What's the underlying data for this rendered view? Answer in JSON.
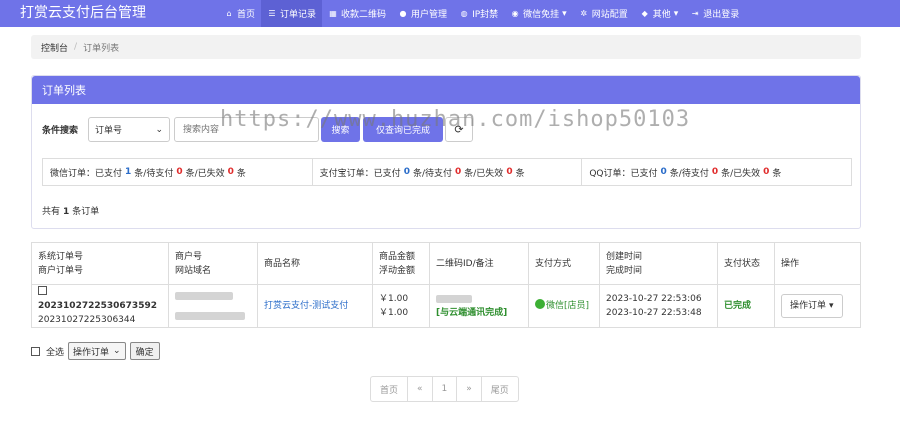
{
  "navbar": {
    "brand": "打赏云支付后台管理",
    "items": [
      {
        "label": "首页",
        "icon": "home-icon",
        "glyph": "⌂"
      },
      {
        "label": "订单记录",
        "icon": "list-icon",
        "glyph": "☰"
      },
      {
        "label": "收款二维码",
        "icon": "qrcode-icon",
        "glyph": "▦"
      },
      {
        "label": "用户管理",
        "icon": "user-icon",
        "glyph": "●"
      },
      {
        "label": "IP封禁",
        "icon": "globe-icon",
        "glyph": "◍"
      },
      {
        "label": "微信免挂",
        "icon": "wechat-icon",
        "glyph": "◉",
        "caret": "▾"
      },
      {
        "label": "网站配置",
        "icon": "gear-icon",
        "glyph": "✲"
      },
      {
        "label": "其他",
        "icon": "shield-icon",
        "glyph": "◆",
        "caret": "▾"
      },
      {
        "label": "退出登录",
        "icon": "logout-icon",
        "glyph": "⇥"
      }
    ]
  },
  "breadcrumb": {
    "home": "控制台",
    "separator": "/",
    "current": "订单列表"
  },
  "panel": {
    "title": "订单列表",
    "search_label": "条件搜索",
    "select_value": "订单号",
    "search_placeholder": "搜索内容",
    "search_button": "搜索",
    "reset_button": "仅查询已完成",
    "refresh_icon": "refresh-icon"
  },
  "stats": [
    {
      "prefix": "微信订单：已支付",
      "paid": "1",
      "mid1": "条/待支付",
      "pending": "0",
      "mid2": "条/已失效",
      "expired": "0",
      "suffix": "条"
    },
    {
      "prefix": "支付宝订单：已支付",
      "paid": "0",
      "mid1": "条/待支付",
      "pending": "0",
      "mid2": "条/已失效",
      "expired": "0",
      "suffix": "条"
    },
    {
      "prefix": "QQ订单：已支付",
      "paid": "0",
      "mid1": "条/待支付",
      "pending": "0",
      "mid2": "条/已失效",
      "expired": "0",
      "suffix": "条"
    }
  ],
  "order_count": {
    "prefix": "共有",
    "count": "1",
    "suffix": "条订单"
  },
  "watermark": "https://www.huzhan.com/ishop50103",
  "table": {
    "headers": [
      {
        "line1": "系统订单号",
        "line2": "商户订单号"
      },
      {
        "line1": "商户号",
        "line2": "网站域名"
      },
      {
        "line1": "商品名称",
        "line2": ""
      },
      {
        "line1": "商品金额",
        "line2": "浮动金额"
      },
      {
        "line1": "二维码ID/备注",
        "line2": ""
      },
      {
        "line1": "支付方式",
        "line2": ""
      },
      {
        "line1": "创建时间",
        "line2": "完成时间"
      },
      {
        "line1": "支付状态",
        "line2": ""
      },
      {
        "line1": "操作",
        "line2": ""
      }
    ],
    "rows": [
      {
        "system_order_no": "2023102722530673592",
        "merchant_order_no": "20231027225306344",
        "product_name": "打赏云支付-测试支付",
        "amount": "￥1.00",
        "float_amount": "￥1.00",
        "remark": "[与云端通讯完成]",
        "pay_method": "微信[店员]",
        "created_at": "2023-10-27 22:53:06",
        "completed_at": "2023-10-27 22:53:48",
        "status": "已完成",
        "action": "操作订单",
        "action_caret": "▾"
      }
    ]
  },
  "bulk": {
    "select_all": "全选",
    "action_value": "操作订单",
    "confirm": "确定"
  },
  "pagination": [
    "首页",
    "«",
    "1",
    "»",
    "尾页"
  ],
  "colors": {
    "primary": "#6f73e8",
    "link": "#2a6cc9",
    "success": "#2f8f2f",
    "danger": "#e02c2c"
  }
}
